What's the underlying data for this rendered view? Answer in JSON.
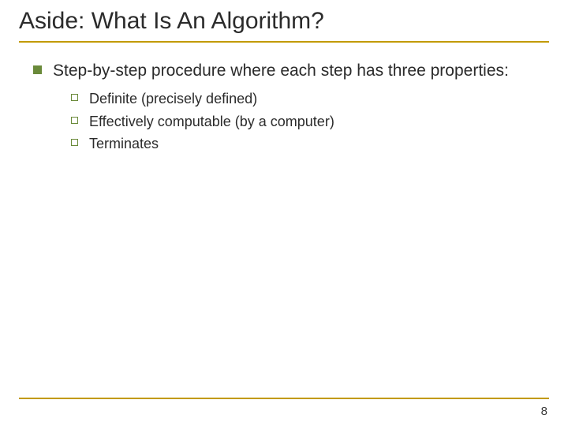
{
  "title": "Aside: What Is An Algorithm?",
  "main_point": "Step-by-step procedure where each step has three properties:",
  "sub": {
    "a": "Definite (precisely defined)",
    "b": "Effectively computable (by a computer)",
    "c": "Terminates"
  },
  "page_number": "8",
  "colors": {
    "accent_rule": "#c29a00",
    "bullet": "#6a8a3a"
  }
}
